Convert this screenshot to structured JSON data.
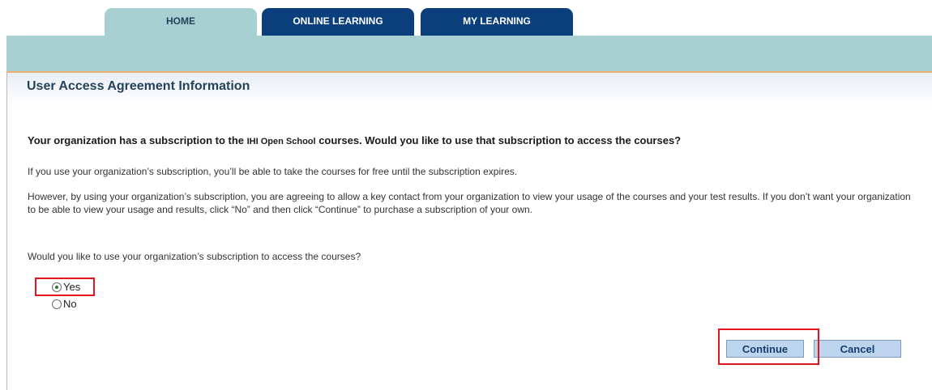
{
  "nav": {
    "tabs": [
      {
        "label": "HOME",
        "active": true
      },
      {
        "label": "ONLINE LEARNING",
        "active": false
      },
      {
        "label": "MY LEARNING",
        "active": false
      }
    ]
  },
  "page": {
    "title": "User Access Agreement Information",
    "question_main_pre": "Your organization has a subscription to the ",
    "question_main_brand": "IHI Open School",
    "question_main_post": " courses. Would you like to use that subscription to access the courses?",
    "paragraph_1": "If you use your organization’s subscription, you’ll be able to take the courses for free until the subscription expires.",
    "paragraph_2": "However, by using your organization’s subscription, you are agreeing to allow a key contact from your organization to view your usage of the courses and your test results. If you don’t want your organization to be able to view your usage and results, click “No” and then click “Continue” to purchase a subscription of your own.",
    "question_2": "Would you like to use your organization’s subscription to access the courses?"
  },
  "form": {
    "options": [
      {
        "label": "Yes",
        "selected": true
      },
      {
        "label": "No",
        "selected": false
      }
    ],
    "continue_label": "Continue",
    "cancel_label": "Cancel"
  },
  "colors": {
    "tab_dark": "#0a3f7c",
    "band_teal": "#a8d0d2",
    "highlight_red": "#e3141f",
    "button_fill": "#bcd4ec"
  }
}
